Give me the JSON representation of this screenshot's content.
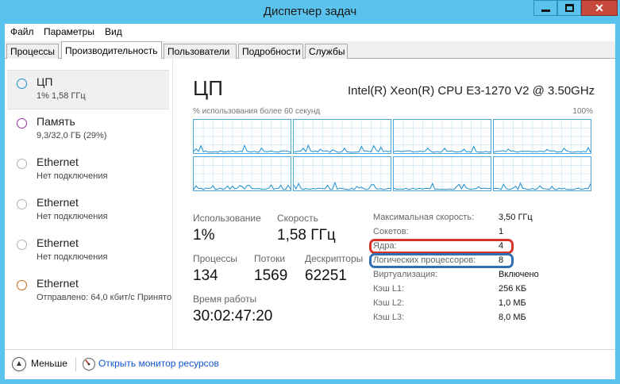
{
  "window": {
    "title": "Диспетчер задач",
    "close_glyph": "✕"
  },
  "menu": [
    "Файл",
    "Параметры",
    "Вид"
  ],
  "tabs": [
    "Процессы",
    "Производительность",
    "Пользователи",
    "Подробности",
    "Службы"
  ],
  "sidebar": [
    {
      "name": "ЦП",
      "sub": "1% 1,58 ГГц",
      "color": "#1c8fd0",
      "selected": true
    },
    {
      "name": "Память",
      "sub": "9,3/32,0 ГБ (29%)",
      "color": "#9b2ea6"
    },
    {
      "name": "Ethernet",
      "sub": "Нет подключения",
      "color": "#b0b0b0"
    },
    {
      "name": "Ethernet",
      "sub": "Нет подключения",
      "color": "#b0b0b0"
    },
    {
      "name": "Ethernet",
      "sub": "Нет подключения",
      "color": "#b0b0b0"
    },
    {
      "name": "Ethernet",
      "sub": "Отправлено: 64,0 кбит/с  Принято",
      "color": "#c66a12"
    }
  ],
  "cpu": {
    "title": "ЦП",
    "model": "Intel(R) Xeon(R) CPU E3-1270 V2 @ 3.50GHz",
    "graph_caption": "% использования более 60 секунд",
    "graph_max": "100%"
  },
  "stats": {
    "usage_label": "Использование",
    "usage_value": "1%",
    "speed_label": "Скорость",
    "speed_value": "1,58 ГГц",
    "processes_label": "Процессы",
    "processes_value": "134",
    "threads_label": "Потоки",
    "threads_value": "1569",
    "handles_label": "Дескрипторы",
    "handles_value": "62251",
    "uptime_label": "Время работы",
    "uptime_value": "30:02:47:20"
  },
  "specs": [
    {
      "label": "Максимальная скорость:",
      "value": "3,50 ГГц"
    },
    {
      "label": "Сокетов:",
      "value": "1"
    },
    {
      "label": "Ядра:",
      "value": "4"
    },
    {
      "label": "Логических процессоров:",
      "value": "8"
    },
    {
      "label": "Виртуализация:",
      "value": "Включено"
    },
    {
      "label": "Кэш L1:",
      "value": "256 КБ"
    },
    {
      "label": "Кэш L2:",
      "value": "1,0 МБ"
    },
    {
      "label": "Кэш L3:",
      "value": "8,0 МБ"
    }
  ],
  "highlight_colors": {
    "cores": "#d7342c",
    "logical": "#2f6fb4"
  },
  "bottom": {
    "fewer": "Меньше",
    "monitor_link": "Открыть монитор ресурсов"
  }
}
